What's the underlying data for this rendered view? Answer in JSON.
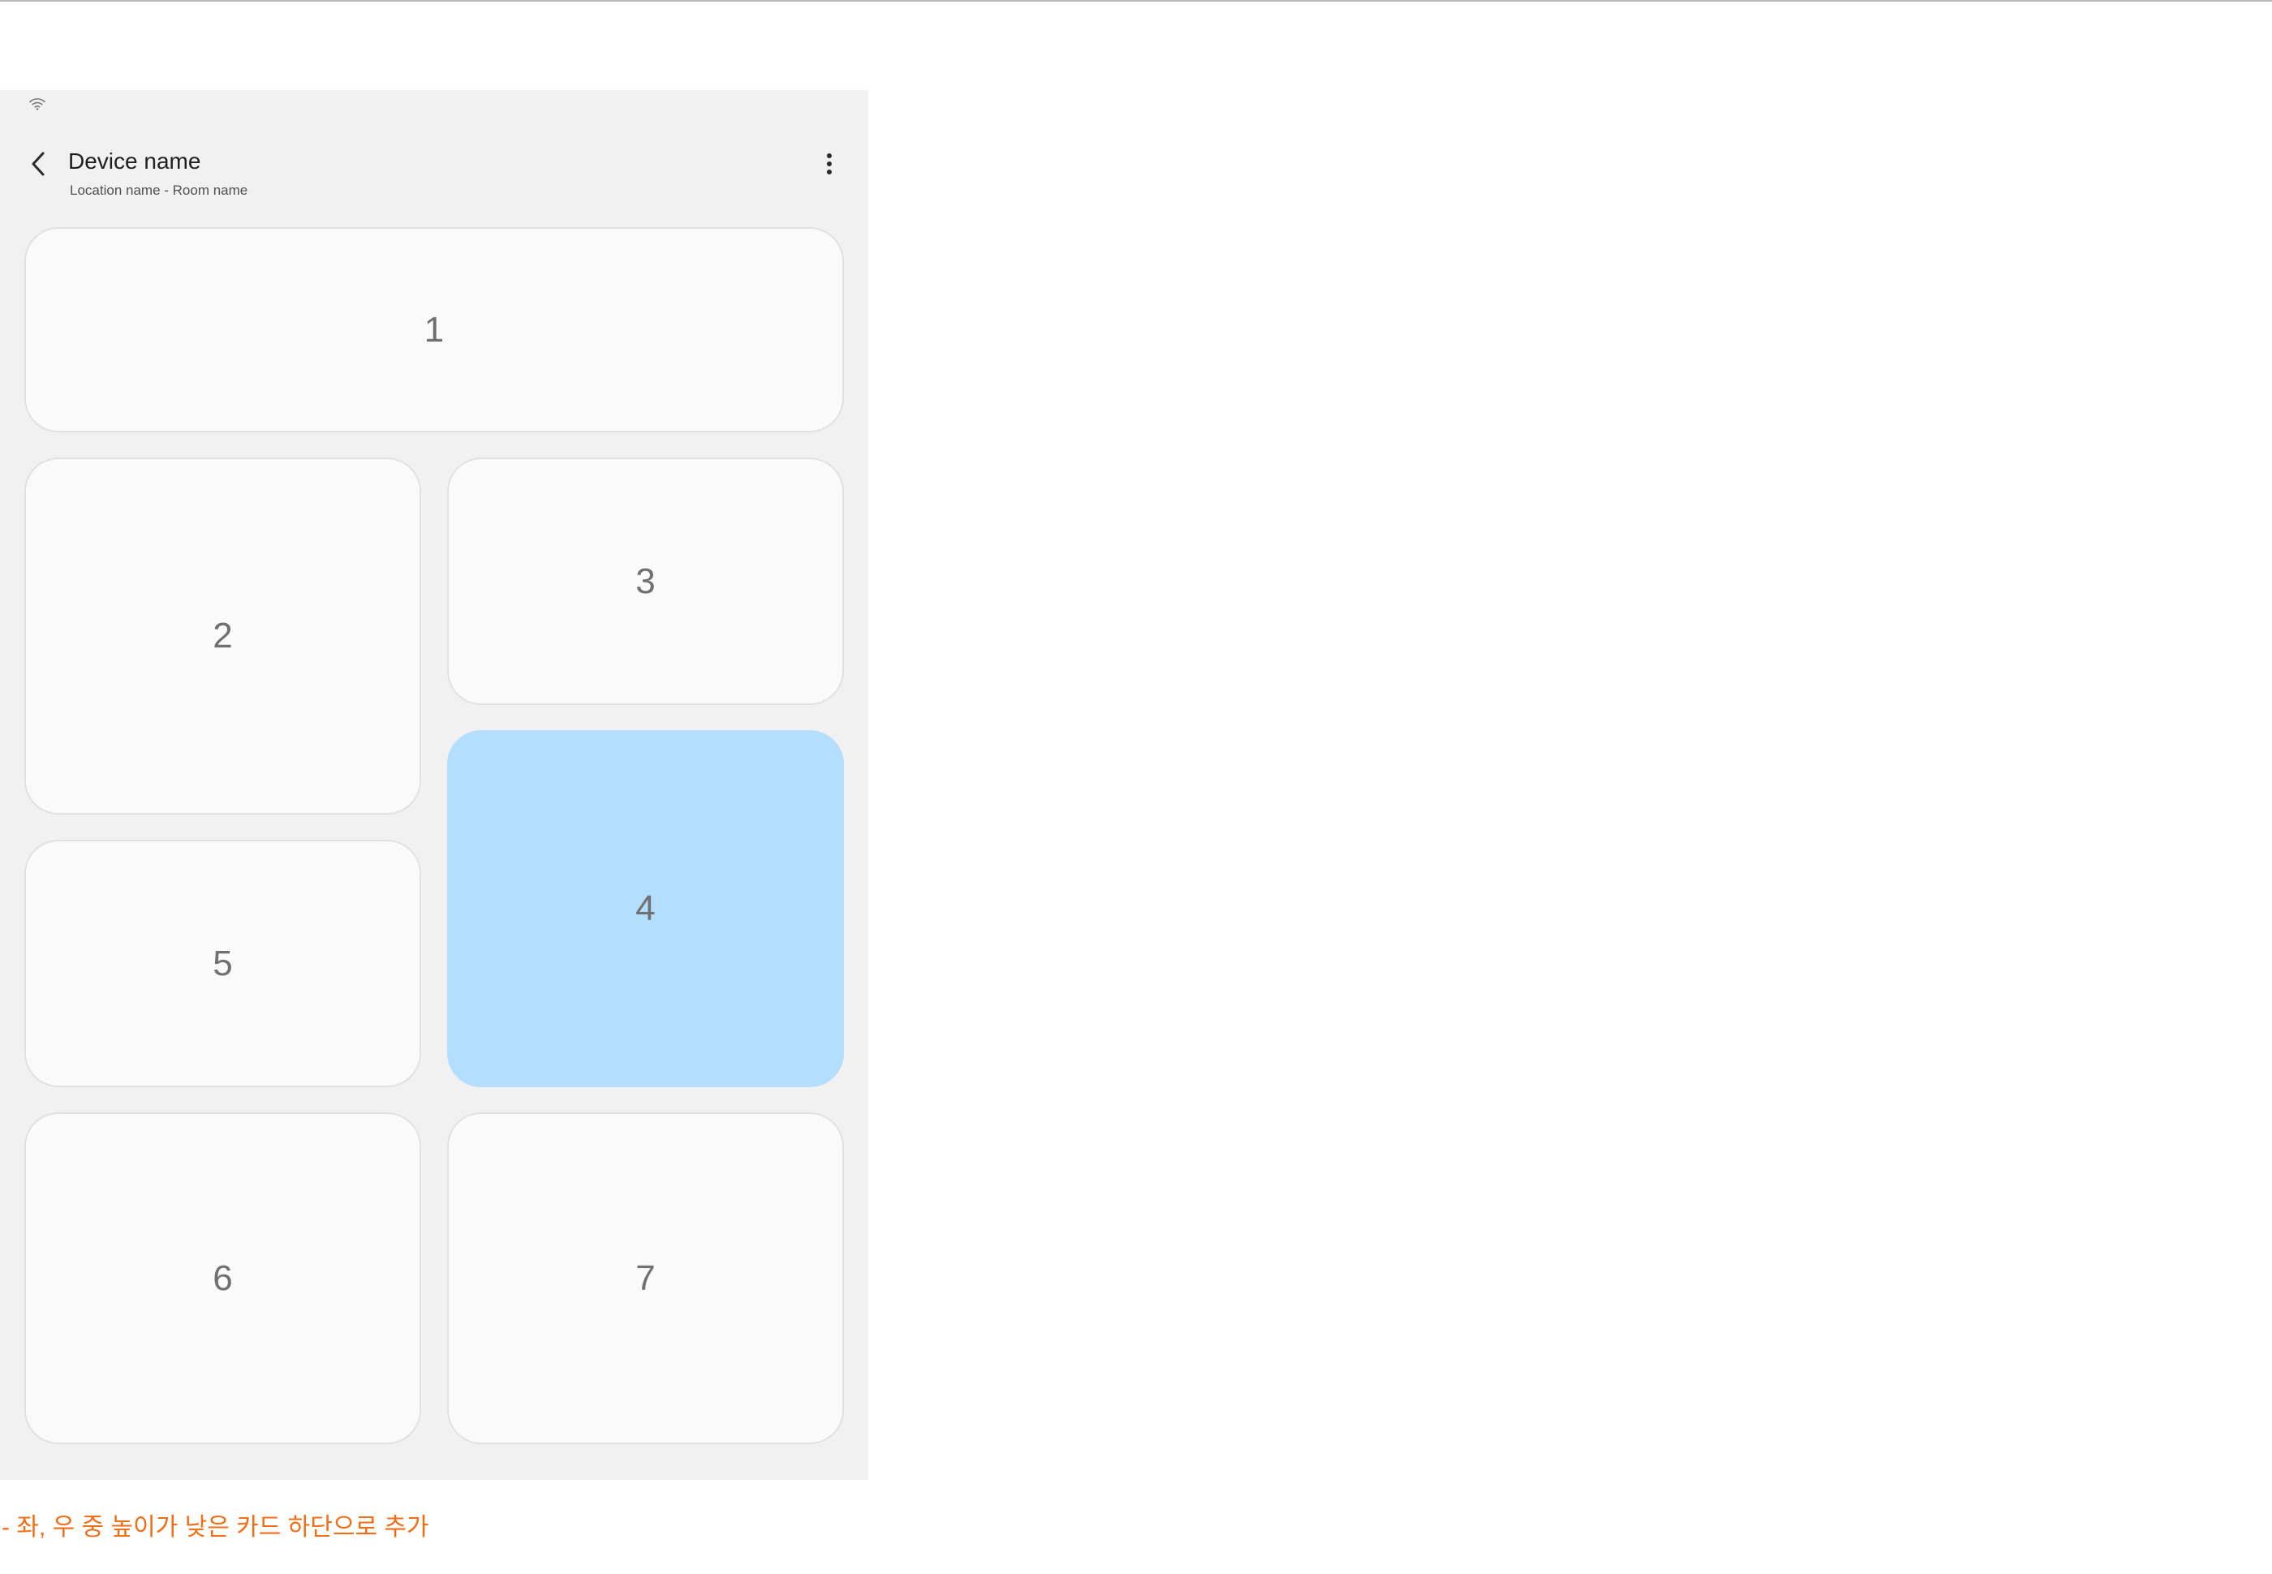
{
  "app_bar": {
    "title": "Device name",
    "subtitle": "Location name - Room name"
  },
  "icons": {
    "status": "wifi-icon",
    "back": "chevron-left-icon",
    "more": "more-vertical-icon"
  },
  "colors": {
    "screen_background": "#f1f1f1",
    "card_background": "#fafafa",
    "card_selected": "#b3defd",
    "note_text": "#f36d14"
  },
  "cards": [
    {
      "label": "1",
      "selected": false
    },
    {
      "label": "2",
      "selected": false
    },
    {
      "label": "3",
      "selected": false
    },
    {
      "label": "4",
      "selected": true
    },
    {
      "label": "5",
      "selected": false
    },
    {
      "label": "6",
      "selected": false
    },
    {
      "label": "7",
      "selected": false
    }
  ],
  "note": "- 좌, 우 중 높이가 낮은 카드 하단으로 추가"
}
